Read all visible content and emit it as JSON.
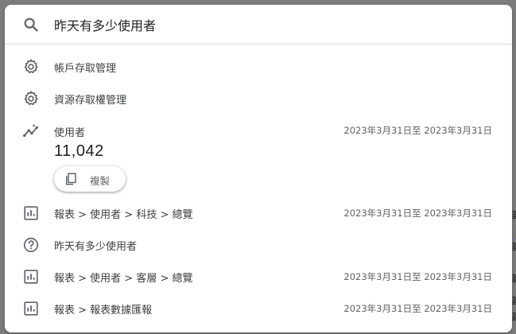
{
  "search": {
    "query": "昨天有多少使用者"
  },
  "settings_items": [
    {
      "label": "帳戶存取管理",
      "icon": "gear-icon"
    },
    {
      "label": "資源存取權管理",
      "icon": "gear-icon"
    }
  ],
  "insight": {
    "label": "使用者",
    "date_range": "2023年3月31日至 2023年3月31日",
    "value": "11,042",
    "icon": "insights-icon",
    "copy_label": "複製"
  },
  "results": [
    {
      "label": "報表 > 使用者 > 科技 > 總覽",
      "date_range": "2023年3月31日至 2023年3月31日",
      "icon": "report-chart-icon"
    },
    {
      "label": "昨天有多少使用者",
      "date_range": "",
      "icon": "help-icon"
    },
    {
      "label": "報表 > 使用者 > 客層 > 總覽",
      "date_range": "2023年3月31日至 2023年3月31日",
      "icon": "report-chart-icon"
    },
    {
      "label": "報表 > 報表數據匯報",
      "date_range": "2023年3月31日至 2023年3月31日",
      "icon": "report-chart-icon"
    }
  ],
  "background_fragments": [
    "蓋",
    "蓋",
    "蓋",
    "蓋",
    "蓋"
  ],
  "colors": {
    "icon": "#5f6368",
    "text": "#3c4043",
    "divider": "#dadce0",
    "overlay": "#7d7d7d"
  }
}
